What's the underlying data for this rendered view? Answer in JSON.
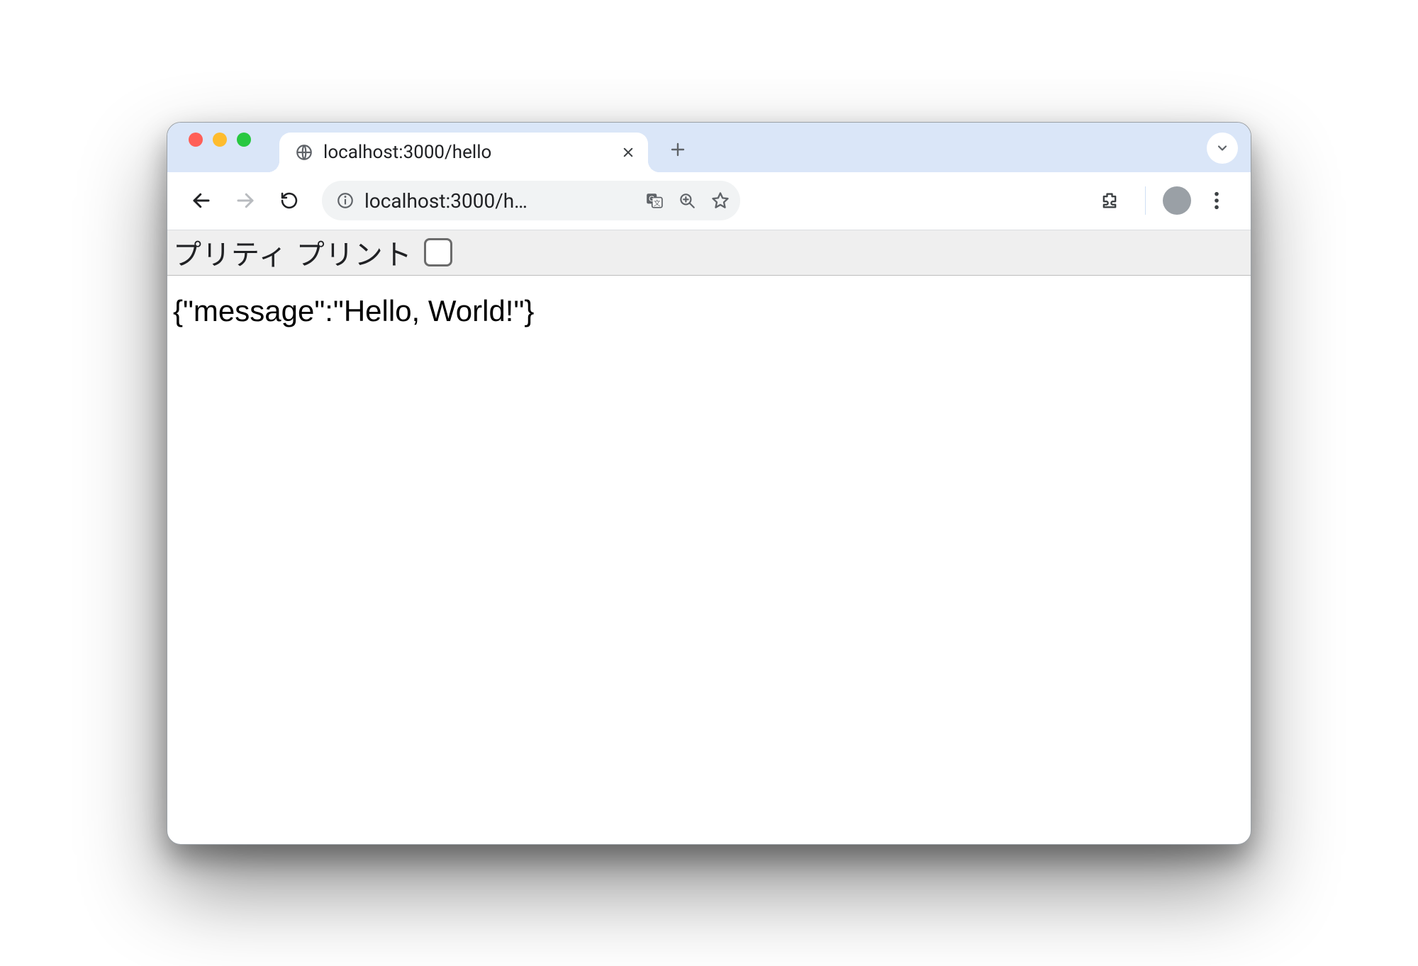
{
  "tab": {
    "title": "localhost:3000/hello"
  },
  "addressbar": {
    "url_display": "localhost:3000/h…"
  },
  "pretty_print": {
    "label": "プリティ プリント",
    "checked": false
  },
  "page": {
    "body_text": "{\"message\":\"Hello, World!\"}"
  }
}
